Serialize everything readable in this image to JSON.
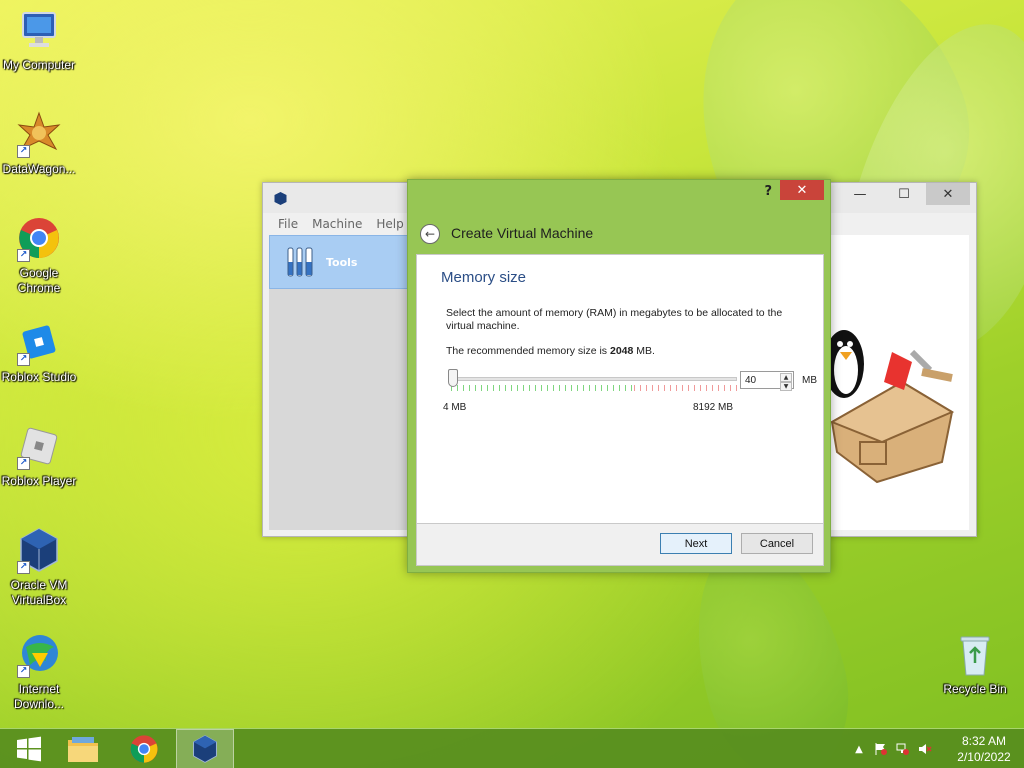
{
  "desktop": {
    "icons": [
      {
        "label": "My Computer",
        "icon": "computer-icon"
      },
      {
        "label": "DataWagon...",
        "icon": "datawagon-icon"
      },
      {
        "label": "Google Chrome",
        "icon": "chrome-icon"
      },
      {
        "label": "Roblox Studio",
        "icon": "roblox-studio-icon"
      },
      {
        "label": "Roblox Player",
        "icon": "roblox-player-icon"
      },
      {
        "label": "Oracle VM VirtualBox",
        "icon": "virtualbox-icon"
      },
      {
        "label": "Internet Downlo...",
        "icon": "internet-download-manager-icon"
      },
      {
        "label": "Recycle Bin",
        "icon": "recycle-bin-icon"
      }
    ]
  },
  "manager": {
    "menu": [
      "File",
      "Machine",
      "Help"
    ],
    "tools_label": "Tools",
    "controls": {
      "minimize": "—",
      "maximize": "☐",
      "close": "✕"
    }
  },
  "wizard": {
    "help": "?",
    "close": "✕",
    "title": "Create Virtual Machine",
    "heading": "Memory size",
    "description": "Select the amount of memory (RAM) in megabytes to be allocated to the virtual machine.",
    "recommended_prefix": "The recommended memory size is",
    "recommended_value": "2048",
    "recommended_suffix": "MB.",
    "slider": {
      "min_label": "4 MB",
      "max_label": "8192 MB",
      "min": 4,
      "max": 8192,
      "value": 40
    },
    "memory_value": "40",
    "unit": "MB",
    "buttons": {
      "next": "Next",
      "cancel": "Cancel"
    }
  },
  "taskbar": {
    "items": [
      "start-icon",
      "file-explorer-icon",
      "chrome-icon",
      "virtualbox-icon"
    ],
    "clock": {
      "time": "8:32 AM",
      "date": "2/10/2022"
    }
  },
  "colors": {
    "window_frame": "#97c654",
    "close_button": "#c9443a",
    "heading": "#2b4e86",
    "selected_tool": "#a9cdf3"
  }
}
